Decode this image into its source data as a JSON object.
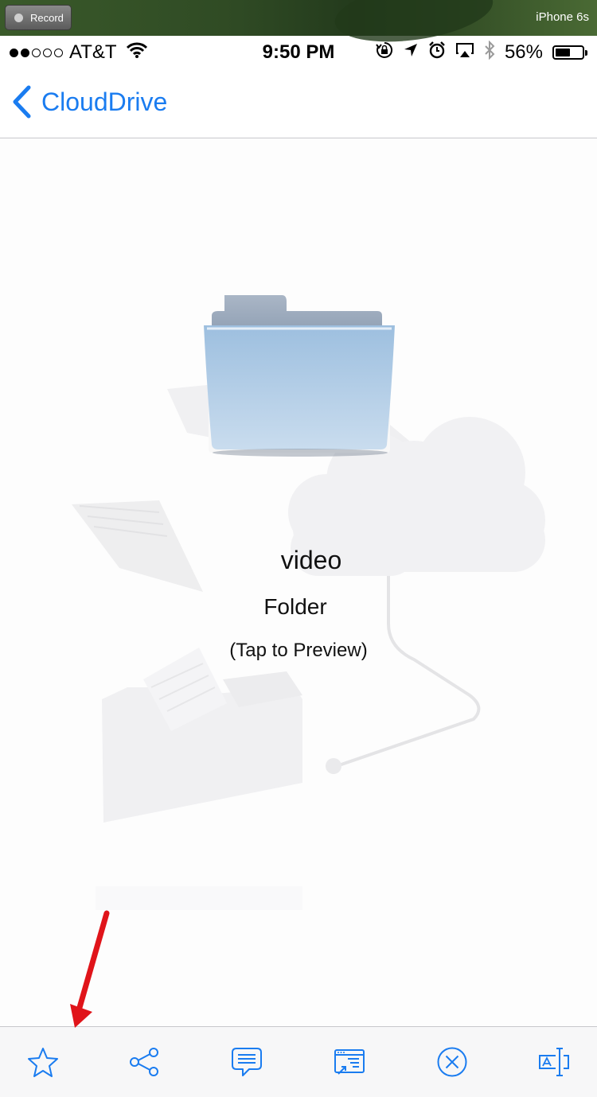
{
  "simulator": {
    "record_label": "Record",
    "device_name": "iPhone 6s"
  },
  "status_bar": {
    "carrier": "AT&T",
    "time": "9:50 PM",
    "battery_percent": "56%",
    "battery_level": 0.56,
    "signal_bars": 2,
    "icons": [
      "wifi-icon",
      "orientation-lock-icon",
      "location-icon",
      "alarm-icon",
      "airplay-icon",
      "bluetooth-icon",
      "battery-icon"
    ]
  },
  "nav": {
    "back_label": "CloudDrive"
  },
  "file": {
    "name": "video",
    "kind": "Folder",
    "hint": "(Tap to Preview)"
  },
  "toolbar": {
    "items": [
      "star-icon",
      "share-icon",
      "comment-icon",
      "open-in-icon",
      "close-circle-icon",
      "rename-icon"
    ]
  },
  "colors": {
    "accent": "#1a7cf0",
    "annotation": "#e0141a",
    "folder": "#9fc0e0"
  }
}
